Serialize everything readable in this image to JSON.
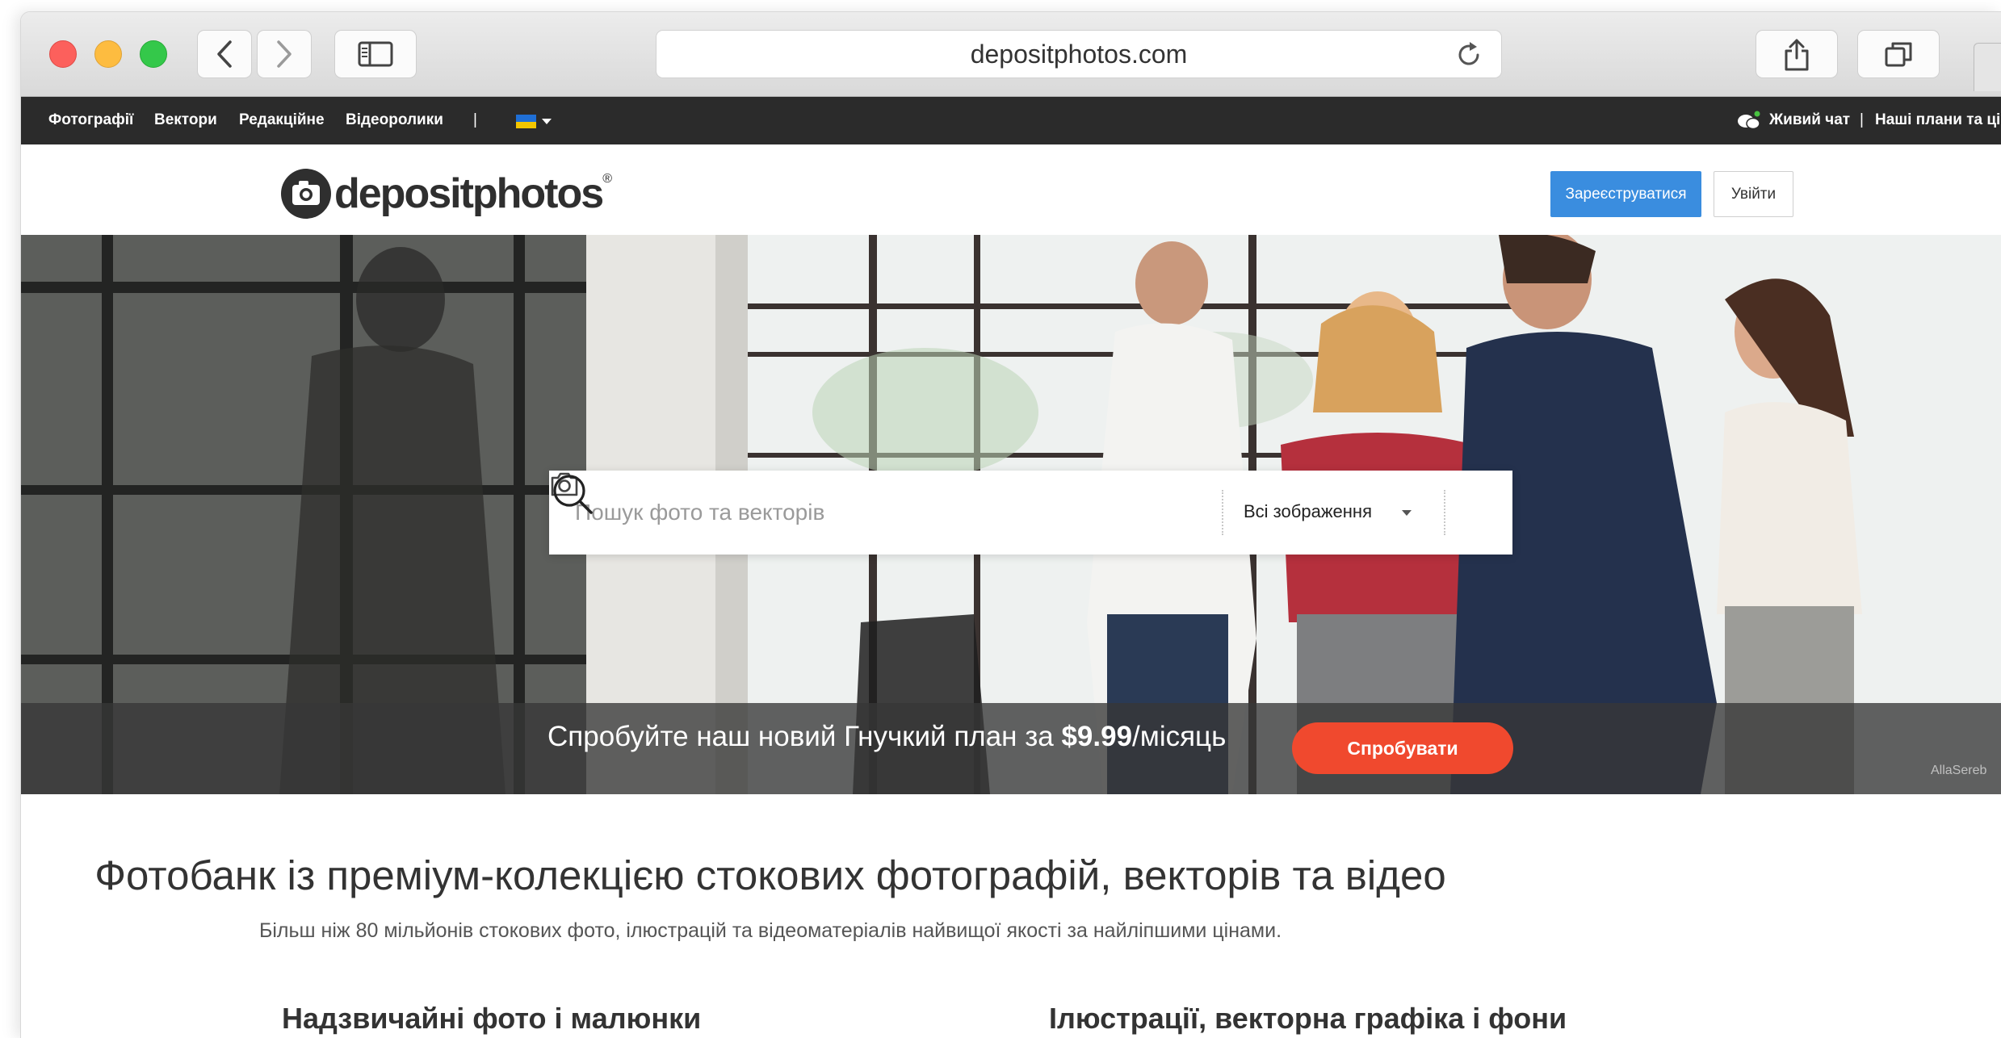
{
  "browser": {
    "url": "depositphotos.com"
  },
  "topnav": {
    "items": [
      "Фотографії",
      "Вектори",
      "Редакційне",
      "Відеоролики"
    ],
    "separator": "|",
    "chat": "Живий чат",
    "chat_separator": "|",
    "plans": "Наші плани та ці"
  },
  "header": {
    "logo_text": "depositphotos",
    "logo_reg": "®",
    "register_label": "Зареєструватися",
    "login_label": "Увійти"
  },
  "search": {
    "placeholder": "Пошук фото та векторів",
    "type_selected": "Всі зображення"
  },
  "promo": {
    "text_before": "Спробуйте наш новий Гнучкий план за ",
    "price": "$9.99",
    "text_after": "/місяць",
    "button_label": "Спробувати",
    "credit": "AllaSereb"
  },
  "content": {
    "headline": "Фотобанк із преміум-колекцією стокових фотографій, векторів та відео",
    "subhead": "Більш ніж 80 мільйонів стокових фото, ілюстрацій та відеоматеріалів найвищої якості за найліпшими цінами.",
    "section_left": "Надзвичайні фото і малюнки",
    "section_right": "Ілюстрації, векторна графіка і фони"
  },
  "colors": {
    "nav_bg": "#2b2b2b",
    "register_bg": "#3a8ddf",
    "try_bg": "#f0492e",
    "flag_blue": "#1f6fd6",
    "flag_yellow": "#f2c500"
  }
}
